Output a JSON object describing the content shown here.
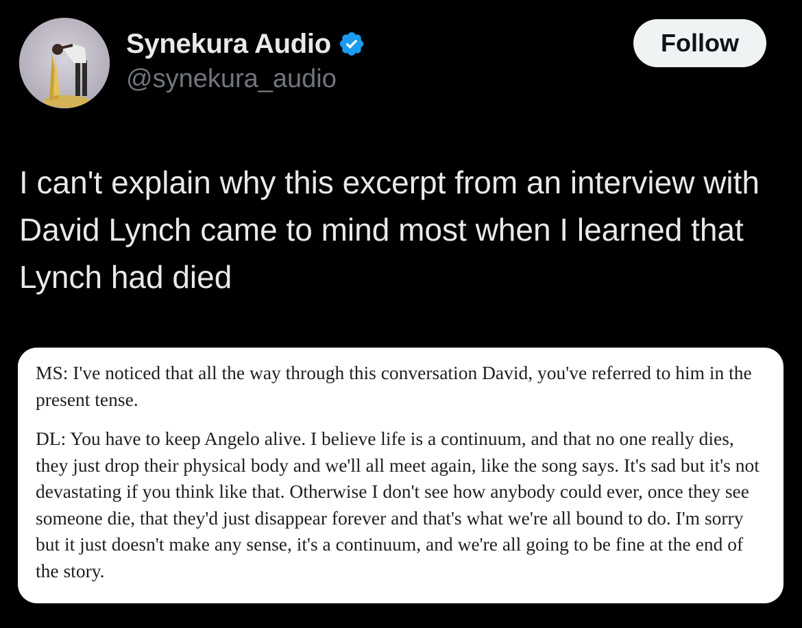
{
  "author": {
    "display_name": "Synekura Audio",
    "handle": "@synekura_audio",
    "verified": true,
    "avatar_icon": "avatar-photo"
  },
  "follow_button": {
    "label": "Follow"
  },
  "tweet": {
    "text": "I can't explain why this excerpt from an interview with David Lynch came to mind most when I learned that Lynch had died"
  },
  "media": {
    "paragraphs": [
      "MS: I've noticed that all the way through this conversation David, you've referred to him in the present tense.",
      "DL: You have to keep Angelo alive. I believe life is a continuum, and that no one really dies, they just drop their physical body and we'll all meet again, like the song says. It's sad but it's not devastating if you think like that. Otherwise I don't see how anybody could ever, once they see someone die, that they'd just disappear forever and that's what we're all bound to do. I'm sorry but it just doesn't make any sense, it's a continuum, and we're all going to be fine at the end of the story."
    ]
  },
  "colors": {
    "background": "#000000",
    "primary_text": "#e7e9ea",
    "secondary_text": "#71767b",
    "verified_badge": "#1d9bf0",
    "follow_button_bg": "#eff3f4",
    "follow_button_text": "#0f1419",
    "card_background": "#ffffff"
  }
}
